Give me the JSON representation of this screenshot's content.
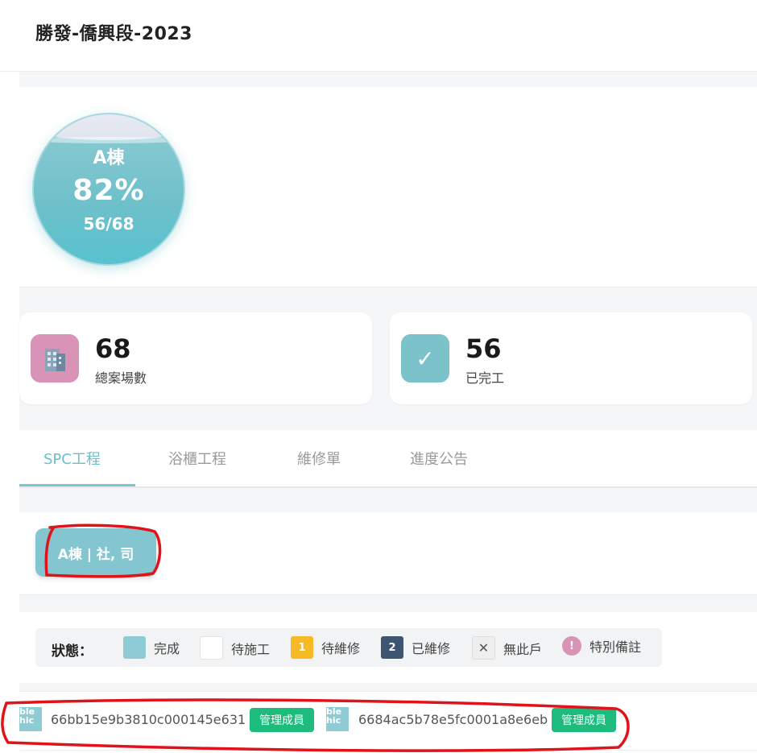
{
  "header": {
    "title": "勝發-僑興段-2023"
  },
  "progress": {
    "building": "A棟",
    "percent": "82%",
    "fraction": "56/68",
    "fill_ratio": 0.82
  },
  "stats": [
    {
      "value": "68",
      "label": "總案場數",
      "icon": "building-icon",
      "color": "#d993b7"
    },
    {
      "value": "56",
      "label": "已完工",
      "icon": "check-icon",
      "color": "#7cc2ca"
    }
  ],
  "tabs": [
    {
      "label": "SPC工程",
      "active": true
    },
    {
      "label": "浴櫃工程",
      "active": false
    },
    {
      "label": "維修單",
      "active": false
    },
    {
      "label": "進度公告",
      "active": false
    }
  ],
  "building_button": {
    "label": "A棟 | 社, 司"
  },
  "legend": {
    "title": "狀態：",
    "items": [
      {
        "label": "完成",
        "swatch": "",
        "color": "#8fcbd4"
      },
      {
        "label": "待施工",
        "swatch": "",
        "color": "#ffffff"
      },
      {
        "label": "待維修",
        "swatch": "1",
        "color": "#f7b924"
      },
      {
        "label": "已維修",
        "swatch": "2",
        "color": "#3d5570"
      },
      {
        "label": "無此戶",
        "swatch": "✕",
        "color": "#eeeeee"
      },
      {
        "label": "特別備註",
        "swatch": "!",
        "color": "#d993b7"
      }
    ]
  },
  "members": [
    {
      "avatar_text": "ble\nhic",
      "id": "66bb15e9b3810c000145e631",
      "badge": "管理成員"
    },
    {
      "avatar_text": "ble\nhic",
      "id": "6684ac5b78e5fc0001a8e6eb",
      "badge": "管理成員"
    }
  ],
  "colors": {
    "accent": "#6bbfc8",
    "annotation": "#e0121a",
    "badge": "#1dbb7c"
  }
}
